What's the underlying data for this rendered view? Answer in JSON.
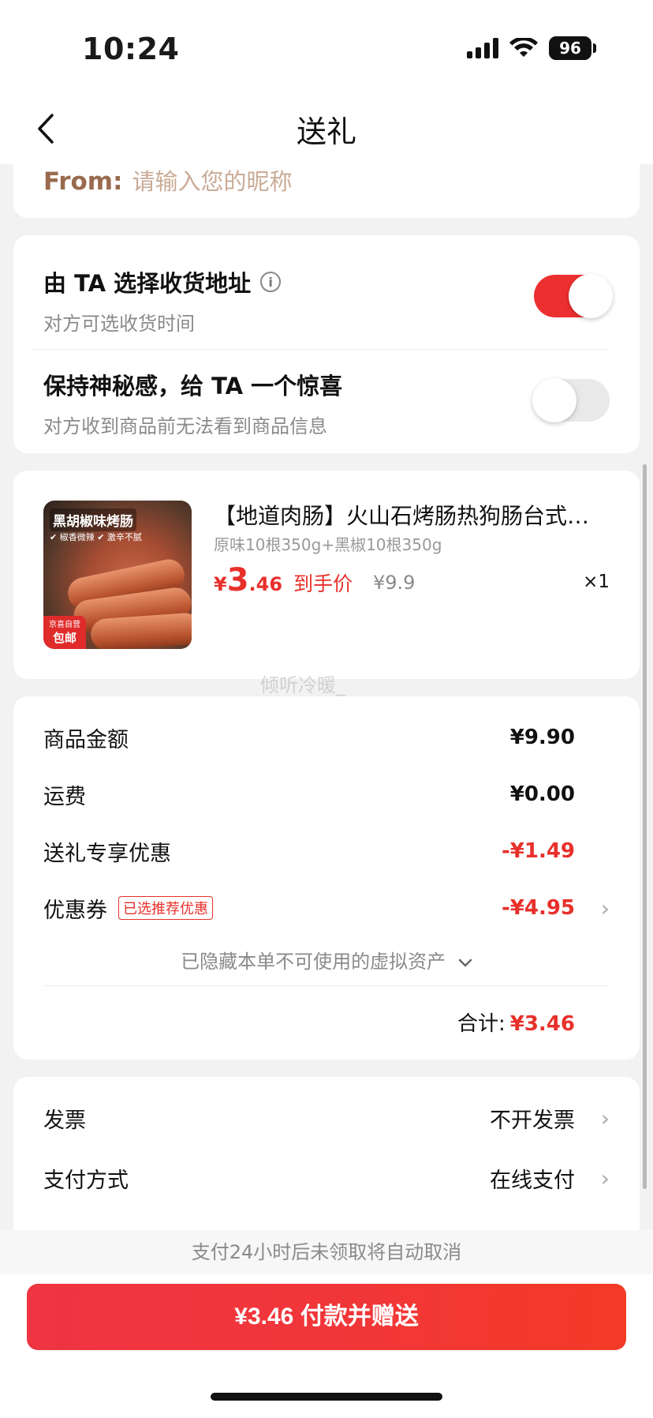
{
  "status_bar": {
    "time": "10:24",
    "battery": "96"
  },
  "nav": {
    "title": "送礼"
  },
  "from": {
    "label": "From:",
    "placeholder": "请输入您的昵称"
  },
  "options": [
    {
      "title": "由 TA 选择收货地址",
      "subtitle": "对方可选收货时间",
      "enabled": true
    },
    {
      "title": "保持神秘感，给 TA 一个惊喜",
      "subtitle": "对方收到商品前无法看到商品信息",
      "enabled": false
    }
  ],
  "product": {
    "title": "【地道肉肠】火山石烤肠热狗肠台式风味烤肠",
    "spec": "原味10根350g+黑椒10根350g",
    "price_currency": "¥",
    "price_int": "3",
    "price_dec": ".46",
    "price_tag": "到手价",
    "original_price": "¥9.9",
    "quantity": "×1",
    "image_title": "黑胡椒味烤肠",
    "image_sub": "✔ 椒香微辣 ✔ 激辛不腻",
    "image_badge_top": "京喜自营",
    "image_badge": "包邮"
  },
  "watermark": "倾听冷暖_",
  "summary": {
    "rows": [
      {
        "label": "商品金额",
        "value": "¥9.90"
      },
      {
        "label": "运费",
        "value": "¥0.00"
      },
      {
        "label": "送礼专享优惠",
        "value": "-¥1.49"
      },
      {
        "label": "优惠券",
        "tag": "已选推荐优惠",
        "value": "-¥4.95"
      }
    ],
    "hidden_assets": "已隐藏本单不可使用的虚拟资产",
    "total_label": "合计:",
    "total_value": "¥3.46"
  },
  "payment": {
    "invoice_label": "发票",
    "invoice_value": "不开发票",
    "method_label": "支付方式",
    "method_value": "在线支付"
  },
  "footer": {
    "note": "支付24小时后未领取将自动取消",
    "button": "¥3.46 付款并赠送"
  },
  "colors": {
    "accent_red": "#e8302b",
    "from_label": "#9a6a4f"
  }
}
